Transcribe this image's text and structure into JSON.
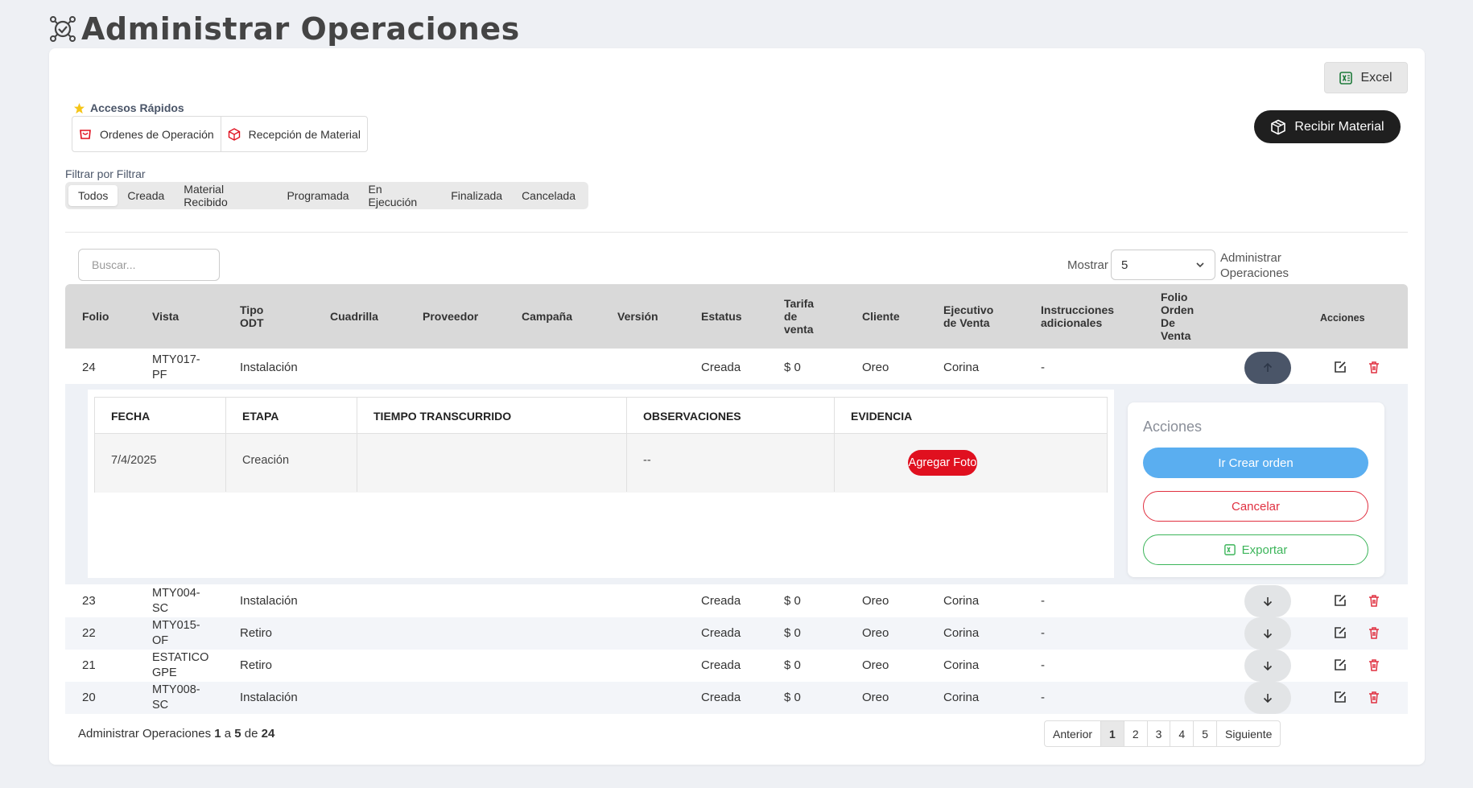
{
  "page": {
    "title": "Administrar Operaciones"
  },
  "toolbar": {
    "excel_label": "Excel",
    "recibir_label": "Recibir Material"
  },
  "quick_access": {
    "title": "Accesos Rápidos",
    "items": [
      {
        "label": "Ordenes de Operación",
        "icon": "cart-icon"
      },
      {
        "label": "Recepción de Material",
        "icon": "box-icon"
      }
    ]
  },
  "filter": {
    "label": "Filtrar por Filtrar",
    "tabs": [
      "Todos",
      "Creada",
      "Material Recibido",
      "Programada",
      "En Ejecución",
      "Finalizada",
      "Cancelada"
    ],
    "active": "Todos"
  },
  "search": {
    "placeholder": "Buscar..."
  },
  "pagesize": {
    "label": "Mostrar",
    "value": "5",
    "suffix_1": "Administrar",
    "suffix_2": "Operaciones"
  },
  "table": {
    "columns": [
      [
        "Folio"
      ],
      [
        "Vista"
      ],
      [
        "Tipo",
        "ODT"
      ],
      [
        "Cuadrilla"
      ],
      [
        "Proveedor"
      ],
      [
        "Campaña"
      ],
      [
        "Versión"
      ],
      [
        "Estatus"
      ],
      [
        "Tarifa",
        "de",
        "venta"
      ],
      [
        "Cliente"
      ],
      [
        "Ejecutivo",
        "de Venta"
      ],
      [
        "Instrucciones",
        "adicionales"
      ],
      [
        "Folio",
        "Orden",
        "De",
        "Venta"
      ],
      [
        "Acciones"
      ]
    ],
    "rows": [
      {
        "folio": "24",
        "vista_1": "MTY017-",
        "vista_2": "PF",
        "tipo": "Instalación",
        "estatus": "Creada",
        "tarifa": "$ 0",
        "cliente": "Oreo",
        "ejecutivo": "Corina",
        "instrucciones": "-"
      },
      {
        "folio": "23",
        "vista_1": "MTY004-",
        "vista_2": "SC",
        "tipo": "Instalación",
        "estatus": "Creada",
        "tarifa": "$ 0",
        "cliente": "Oreo",
        "ejecutivo": "Corina",
        "instrucciones": "-"
      },
      {
        "folio": "22",
        "vista_1": "MTY015-",
        "vista_2": "OF",
        "tipo": "Retiro",
        "estatus": "Creada",
        "tarifa": "$ 0",
        "cliente": "Oreo",
        "ejecutivo": "Corina",
        "instrucciones": "-"
      },
      {
        "folio": "21",
        "vista_1": "ESTATICO",
        "vista_2": "GPE",
        "tipo": "Retiro",
        "estatus": "Creada",
        "tarifa": "$ 0",
        "cliente": "Oreo",
        "ejecutivo": "Corina",
        "instrucciones": "-"
      },
      {
        "folio": "20",
        "vista_1": "MTY008-",
        "vista_2": "SC",
        "tipo": "Instalación",
        "estatus": "Creada",
        "tarifa": "$ 0",
        "cliente": "Oreo",
        "ejecutivo": "Corina",
        "instrucciones": "-"
      }
    ]
  },
  "detail": {
    "headers": [
      "FECHA",
      "ETAPA",
      "TIEMPO TRANSCURRIDO",
      "OBSERVACIONES",
      "EVIDENCIA"
    ],
    "row": {
      "fecha": "7/4/2025",
      "etapa": "Creación",
      "tiempo": "",
      "observaciones": "--"
    },
    "agregar_label": "Agregar Foto",
    "actions": {
      "title": "Acciones",
      "crear": "Ir Crear orden",
      "cancelar": "Cancelar",
      "exportar": "Exportar"
    }
  },
  "footer": {
    "prefix": "Administrar Operaciones",
    "from": "1",
    "connector_a": "a",
    "to": "5",
    "connector_de": "de",
    "total": "24",
    "pager": {
      "prev": "Anterior",
      "pages": [
        "1",
        "2",
        "3",
        "4",
        "5"
      ],
      "current": "1",
      "next": "Siguiente"
    }
  },
  "colors": {
    "primary_dark": "#1f1f1f",
    "danger": "#e0101f",
    "info": "#5aaef0",
    "success": "#3cb55a",
    "header_bg": "#d9d9d9"
  }
}
